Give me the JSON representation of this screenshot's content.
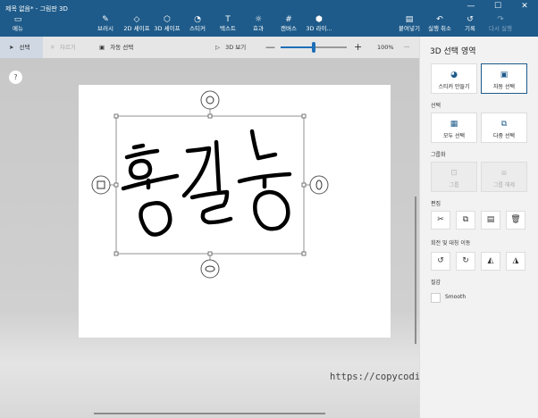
{
  "window": {
    "title": "제목 없음* - 그림판 3D",
    "controls": [
      "—",
      "☐",
      "✕"
    ]
  },
  "ribbon": {
    "menu": {
      "label": "메뉴",
      "icon": "folder-icon"
    },
    "tools": [
      {
        "label": "브러시",
        "icon": "brush-icon"
      },
      {
        "label": "2D 셰이프",
        "icon": "shapes-2d-icon"
      },
      {
        "label": "3D 셰이프",
        "icon": "shapes-3d-icon"
      },
      {
        "label": "스티커",
        "icon": "sticker-icon"
      },
      {
        "label": "텍스트",
        "icon": "text-icon"
      },
      {
        "label": "효과",
        "icon": "effects-icon"
      },
      {
        "label": "캔버스",
        "icon": "canvas-icon"
      },
      {
        "label": "3D 라이...",
        "icon": "library-3d-icon"
      }
    ],
    "right_tools": [
      {
        "label": "붙여넣기",
        "icon": "paste-icon",
        "enabled": true
      },
      {
        "label": "실행 취소",
        "icon": "undo-icon",
        "enabled": true
      },
      {
        "label": "기록",
        "icon": "history-icon",
        "enabled": true
      },
      {
        "label": "다시 실행",
        "icon": "redo-icon",
        "enabled": false
      }
    ]
  },
  "toolbar": {
    "select": "선택",
    "crop": "자르기",
    "magic_select": "자동 선택",
    "view3d": "3D 보기",
    "zoom_minus": "—",
    "zoom_plus": "+",
    "zoom_percent": "100%",
    "zoom_fraction": 0.5,
    "more": "···"
  },
  "canvas": {
    "help": "?",
    "handwriting_text": "홍길동",
    "watermark": "https://copycoding.tistory.com/"
  },
  "panel": {
    "title": "3D 선택 영역",
    "top_buttons": [
      {
        "label": "스티커 만들기",
        "icon": "make-sticker-icon"
      },
      {
        "label": "자동 선택",
        "icon": "magic-select-icon"
      }
    ],
    "select_section": "선택",
    "select_buttons": [
      {
        "label": "모두 선택",
        "icon": "select-all-icon"
      },
      {
        "label": "다중 선택",
        "icon": "multi-select-icon"
      }
    ],
    "group_section": "그룹화",
    "group_buttons": [
      {
        "label": "그룹",
        "icon": "group-icon"
      },
      {
        "label": "그룹 해제",
        "icon": "ungroup-icon"
      }
    ],
    "edit_section": "편집",
    "edit_buttons": [
      "cut-icon",
      "copy-icon",
      "paste-icon",
      "delete-icon"
    ],
    "rotate_section": "회전 및 대칭 이동",
    "rotate_buttons": [
      "rotate-left-icon",
      "rotate-right-icon",
      "flip-horizontal-icon",
      "flip-vertical-icon"
    ],
    "texture_section": "질감",
    "smooth_label": "Smooth"
  },
  "colors": {
    "ribbon": "#1e5b8a",
    "accent": "#1e6fb8",
    "panel": "#f2f2f2"
  }
}
